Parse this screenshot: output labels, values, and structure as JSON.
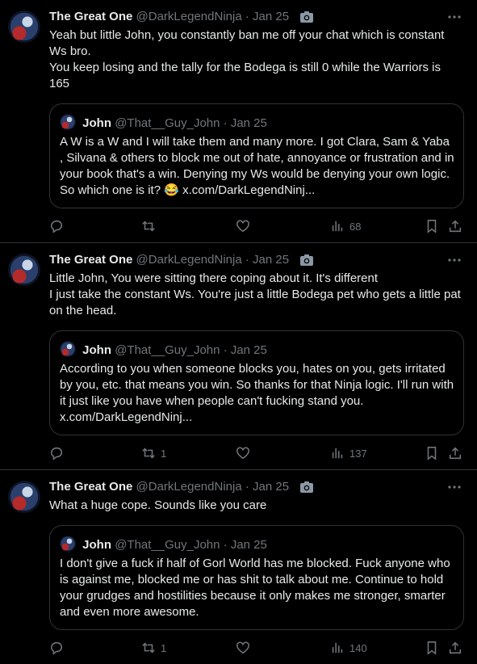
{
  "tweets": [
    {
      "author_name": "The Great One",
      "author_meta": "@DarkLegendNinja · Jan 25",
      "body": [
        "Yeah but little John, you constantly ban me off your chat which is constant Ws bro.",
        "You keep losing and the tally for the Bodega is still 0 while the Warriors is 165"
      ],
      "quote": {
        "author_name": "John",
        "author_meta": "@That__Guy_John · Jan 25",
        "text": "A W is a W and I will take them and many more. I got Clara, Sam & Yaba , Silvana & others to block me out of hate, annoyance or frustration and in your book that's a win. Denying my Ws would be denying your own logic. So which one is it? 😂 x.com/DarkLegendNinj..."
      },
      "replies": "",
      "reposts": "",
      "likes": "",
      "views": "68"
    },
    {
      "author_name": "The Great One",
      "author_meta": "@DarkLegendNinja · Jan 25",
      "body": [
        "Little John, You were sitting there coping about it. It's different",
        "I just take the constant Ws. You're just a little Bodega pet who gets a little pat on the head."
      ],
      "quote": {
        "author_name": "John",
        "author_meta": "@That__Guy_John · Jan 25",
        "text": "According to you when someone blocks you, hates on you, gets irritated by you, etc. that means you win. So thanks for that Ninja logic. I'll run with it just like you have when people can't fucking stand you. x.com/DarkLegendNinj..."
      },
      "replies": "",
      "reposts": "1",
      "likes": "",
      "views": "137"
    },
    {
      "author_name": "The Great One",
      "author_meta": "@DarkLegendNinja · Jan 25",
      "body": [
        "What a huge cope. Sounds like you care"
      ],
      "quote": {
        "author_name": "John",
        "author_meta": "@That__Guy_John · Jan 25",
        "text": "I don't give a fuck if half of Gorl World has me blocked. Fuck anyone who is against me, blocked me or has shit to talk about me.  Continue to hold your grudges and hostilities because it only makes me stronger, smarter and even more awesome."
      },
      "replies": "",
      "reposts": "1",
      "likes": "",
      "views": "140"
    }
  ],
  "icons": {
    "reply": "reply-icon",
    "repost": "repost-icon",
    "like": "heart-icon",
    "views": "views-icon",
    "bookmark": "bookmark-icon",
    "share": "share-icon",
    "more": "more-icon",
    "photo": "camera-icon"
  },
  "colors": {
    "background": "#000000",
    "text": "#e7e9ea",
    "secondary": "#71767b",
    "border": "#2f3336"
  }
}
